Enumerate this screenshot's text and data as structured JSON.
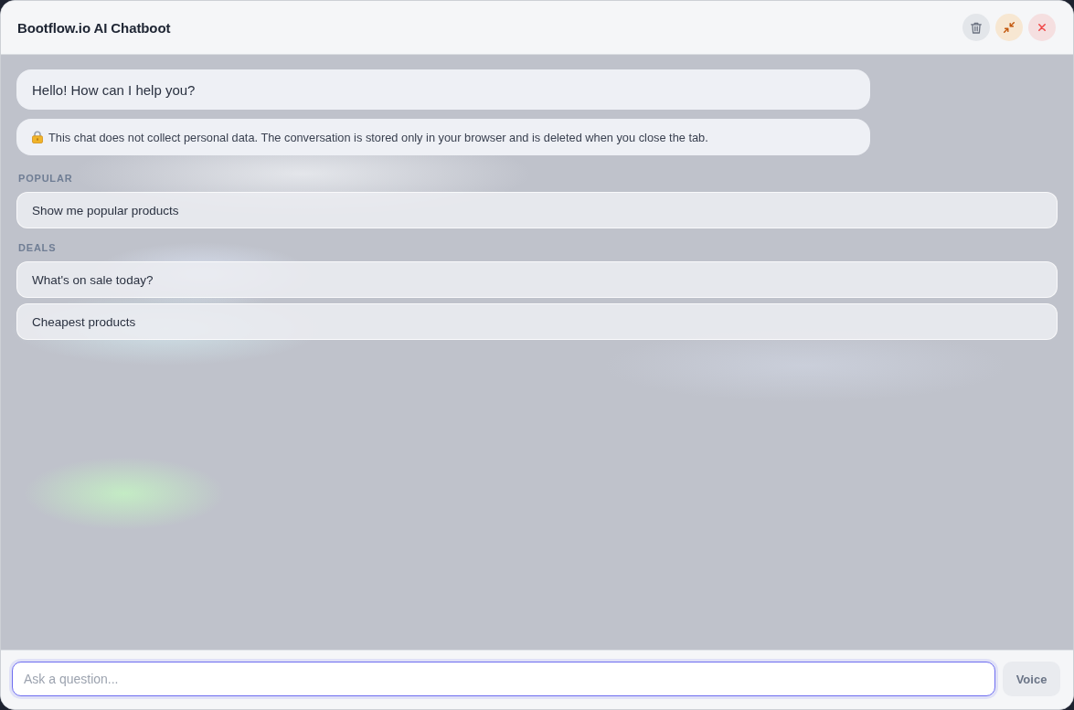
{
  "header": {
    "title": "Bootflow.io AI Chatboot"
  },
  "messages": [
    {
      "kind": "greeting",
      "text": "Hello! How can I help you?"
    },
    {
      "kind": "notice",
      "text": "This chat does not collect personal data. The conversation is stored only in your browser and is deleted when you close the tab."
    }
  ],
  "suggestion_groups": [
    {
      "heading": "POPULAR",
      "items": [
        "Show me popular products"
      ]
    },
    {
      "heading": "DEALS",
      "items": [
        "What's on sale today?",
        "Cheapest products"
      ]
    }
  ],
  "composer": {
    "placeholder": "Ask a question...",
    "focused": true,
    "voice_button": "Voice"
  }
}
